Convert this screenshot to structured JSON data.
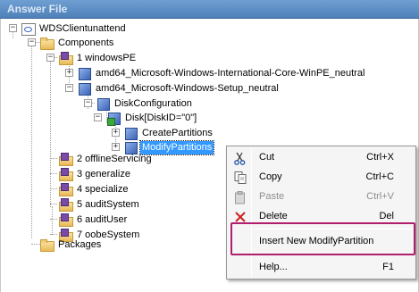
{
  "panel": {
    "title": "Answer File"
  },
  "tree": {
    "root": "WDSClientunattend",
    "components": "Components",
    "windowsPE": "1 windowsPE",
    "intl_core": "amd64_Microsoft-Windows-International-Core-WinPE_neutral",
    "setup": "amd64_Microsoft-Windows-Setup_neutral",
    "disk_configuration": "DiskConfiguration",
    "disk": "Disk[DiskID=\"0\"]",
    "create_partitions": "CreatePartitions",
    "modify_partitions": "ModifyPartitions",
    "offline_servicing": "2 offlineServicing",
    "generalize": "3 generalize",
    "specialize": "4 specialize",
    "audit_system": "5 auditSystem",
    "audit_user": "6 auditUser",
    "oobe_system": "7 oobeSystem",
    "packages": "Packages"
  },
  "context_menu": {
    "cut": {
      "label": "Cut",
      "shortcut": "Ctrl+X",
      "icon": "scissors-icon"
    },
    "copy": {
      "label": "Copy",
      "shortcut": "Ctrl+C",
      "icon": "copy-icon"
    },
    "paste": {
      "label": "Paste",
      "shortcut": "Ctrl+V",
      "icon": "paste-icon",
      "enabled": false
    },
    "delete": {
      "label": "Delete",
      "shortcut": "Del",
      "icon": "delete-icon"
    },
    "insert": {
      "label": "Insert New ModifyPartition"
    },
    "help": {
      "label": "Help...",
      "shortcut": "F1"
    }
  },
  "colors": {
    "header": "#4f80b9",
    "selection": "#3399ff",
    "highlight_border": "#b01e6e"
  }
}
